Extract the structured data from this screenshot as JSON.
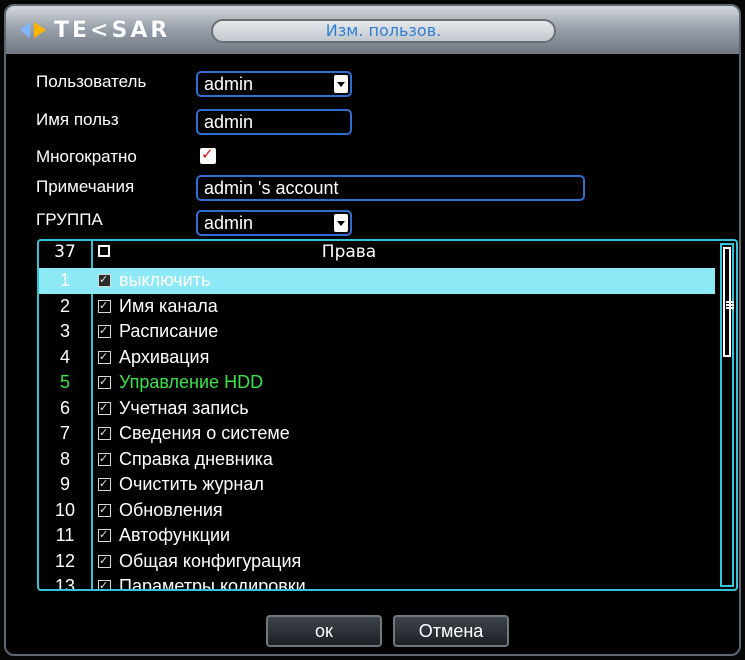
{
  "header": {
    "logo_text": "TE<SAR",
    "title": "Изм. пользов."
  },
  "form": {
    "user_label": "Пользователь",
    "user_value": "admin",
    "username_label": "Имя польз",
    "username_value": "admin",
    "multiple_label": "Многократно",
    "multiple_checked": true,
    "notes_label": "Примечания",
    "notes_value": "admin 's account",
    "group_label": "ГРУППА",
    "group_value": "admin"
  },
  "permissions": {
    "count": "37",
    "header": "Права",
    "rows": [
      {
        "num": "1",
        "name": "выключить",
        "checked": true,
        "selected": true
      },
      {
        "num": "2",
        "name": "Имя канала",
        "checked": true
      },
      {
        "num": "3",
        "name": "Расписание",
        "checked": true
      },
      {
        "num": "4",
        "name": "Архивация",
        "checked": true
      },
      {
        "num": "5",
        "name": "Управление HDD",
        "checked": true,
        "highlight": "#39e34a"
      },
      {
        "num": "6",
        "name": "Учетная запись",
        "checked": true
      },
      {
        "num": "7",
        "name": "Сведения о системе",
        "checked": true
      },
      {
        "num": "8",
        "name": "Справка дневника",
        "checked": true
      },
      {
        "num": "9",
        "name": "Очистить журнал",
        "checked": true
      },
      {
        "num": "10",
        "name": "Обновления",
        "checked": true
      },
      {
        "num": "11",
        "name": "Автофункции",
        "checked": true
      },
      {
        "num": "12",
        "name": "Общая конфигурация",
        "checked": true
      },
      {
        "num": "13",
        "name": "Параметры кодировки",
        "checked": true
      }
    ]
  },
  "buttons": {
    "ok_label": "ок",
    "cancel_label": "Отмена"
  },
  "colors": {
    "accent_blue": "#2c6fd0",
    "list_border": "#36c4d8",
    "selected_row": "#8ee9f7",
    "title_text": "#2f7fd6"
  }
}
